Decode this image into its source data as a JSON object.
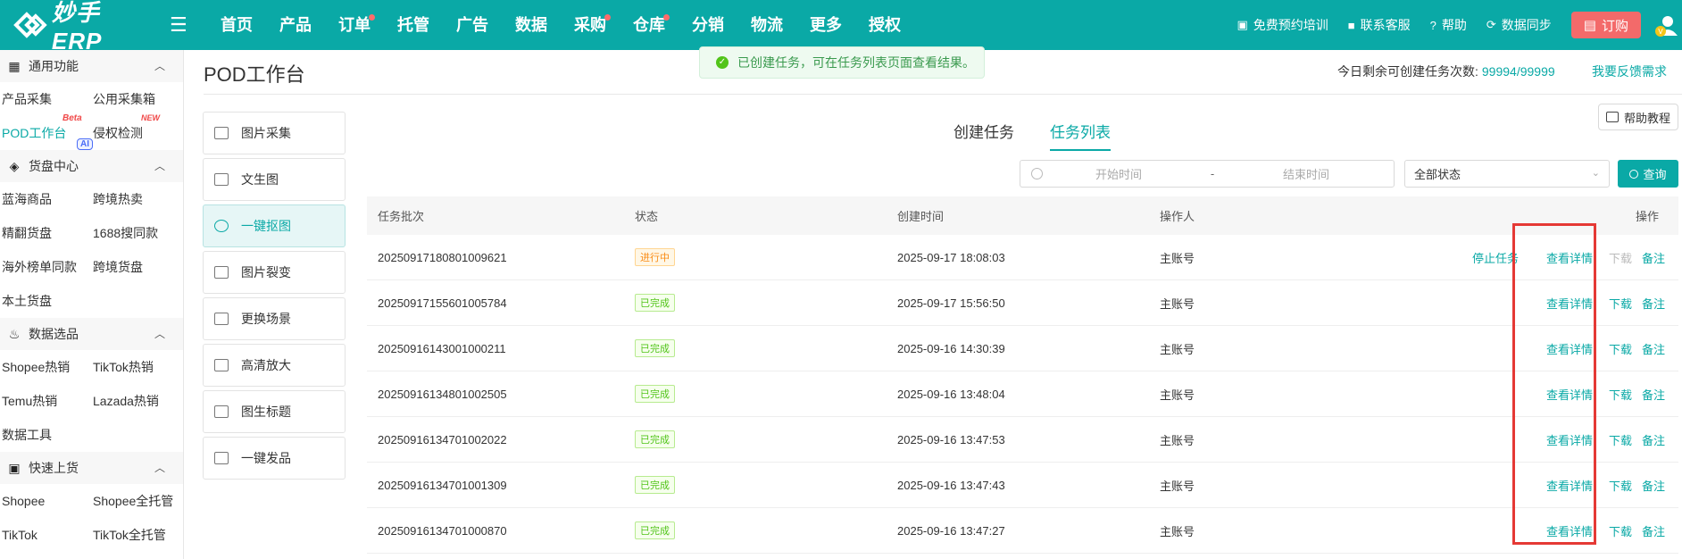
{
  "app": {
    "logo_text": "妙手ERP",
    "nav": [
      {
        "label": "首页",
        "dot": false
      },
      {
        "label": "产品",
        "dot": false
      },
      {
        "label": "订单",
        "dot": true
      },
      {
        "label": "托管",
        "dot": false
      },
      {
        "label": "广告",
        "dot": false
      },
      {
        "label": "数据",
        "dot": false
      },
      {
        "label": "采购",
        "dot": true
      },
      {
        "label": "仓库",
        "dot": true
      },
      {
        "label": "分销",
        "dot": false
      },
      {
        "label": "物流",
        "dot": false
      },
      {
        "label": "更多",
        "dot": false
      },
      {
        "label": "授权",
        "dot": false
      }
    ],
    "top_right": {
      "training": "免费预约培训",
      "support": "联系客服",
      "help": "帮助",
      "sync": "数据同步",
      "order": "订购"
    }
  },
  "sidebar": {
    "sections": [
      {
        "title": "通用功能",
        "icon": "grid-icon",
        "rows": [
          [
            "产品采集",
            "公用采集箱"
          ],
          [
            "POD工作台",
            "侵权检测"
          ]
        ]
      },
      {
        "title": "货盘中心",
        "icon": "box-icon",
        "rows": [
          [
            "蓝海商品",
            "跨境热卖"
          ],
          [
            "精翻货盘",
            "1688搜同款"
          ],
          [
            "海外榜单同款",
            "跨境货盘"
          ],
          [
            "本土货盘",
            ""
          ]
        ]
      },
      {
        "title": "数据选品",
        "icon": "flame-icon",
        "rows": [
          [
            "Shopee热销",
            "TikTok热销"
          ],
          [
            "Temu热销",
            "Lazada热销"
          ],
          [
            "数据工具",
            ""
          ]
        ]
      },
      {
        "title": "快速上货",
        "icon": "bag-icon",
        "rows": [
          [
            "Shopee",
            "Shopee全托管"
          ],
          [
            "TikTok",
            "TikTok全托管"
          ]
        ]
      }
    ],
    "badges": {
      "beta": "Beta",
      "new": "NEW",
      "ai": "AI"
    }
  },
  "page": {
    "title": "POD工作台",
    "toast": "已创建任务，可在任务列表页面查看结果。",
    "quota_label": "今日剩余可创建任务次数:",
    "quota_value": "99994/99999",
    "feedback": "我要反馈需求",
    "help_tutorial": "帮助教程"
  },
  "tools": [
    "图片采集",
    "文生图",
    "一键抠图",
    "图片裂变",
    "更换场景",
    "高清放大",
    "图生标题",
    "一键发品"
  ],
  "tabs": {
    "create": "创建任务",
    "list": "任务列表"
  },
  "filters": {
    "start": "开始时间",
    "sep": "-",
    "end": "结束时间",
    "status": "全部状态",
    "query": "查询"
  },
  "table": {
    "headers": [
      "任务批次",
      "状态",
      "创建时间",
      "操作人",
      "操作"
    ],
    "rows": [
      {
        "id": "20250917180801009621",
        "status": "进行中",
        "time": "2025-09-17 18:08:03",
        "user": "主账号"
      },
      {
        "id": "20250917155601005784",
        "status": "已完成",
        "time": "2025-09-17 15:56:50",
        "user": "主账号"
      },
      {
        "id": "20250916143001000211",
        "status": "已完成",
        "time": "2025-09-16 14:30:39",
        "user": "主账号"
      },
      {
        "id": "20250916134801002505",
        "status": "已完成",
        "time": "2025-09-16 13:48:04",
        "user": "主账号"
      },
      {
        "id": "20250916134701002022",
        "status": "已完成",
        "time": "2025-09-16 13:47:53",
        "user": "主账号"
      },
      {
        "id": "20250916134701001309",
        "status": "已完成",
        "time": "2025-09-16 13:47:43",
        "user": "主账号"
      },
      {
        "id": "20250916134701000870",
        "status": "已完成",
        "time": "2025-09-16 13:47:27",
        "user": "主账号"
      }
    ],
    "ops": {
      "stop": "停止任务",
      "detail": "查看详情",
      "download": "下载",
      "note": "备注"
    }
  },
  "colors": {
    "brand": "#0aa9a6",
    "highlight": "#e53935"
  }
}
